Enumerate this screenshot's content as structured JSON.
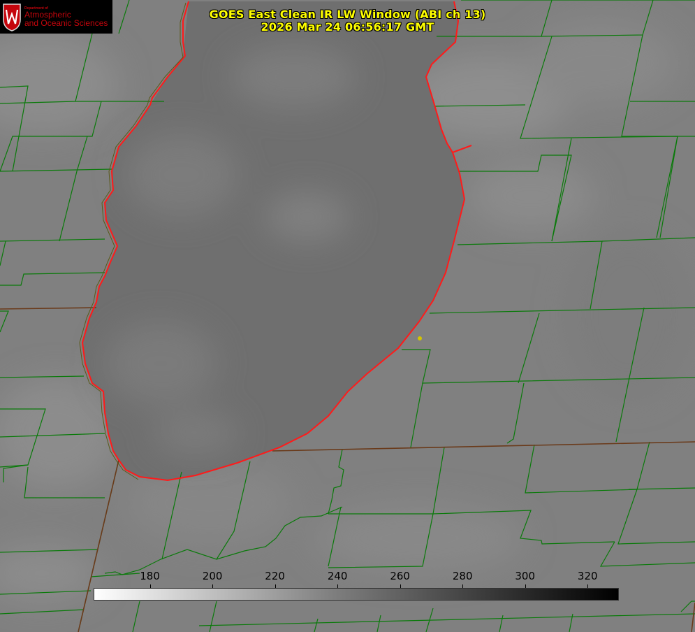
{
  "title": {
    "line1": "GOES East Clean IR LW Window (ABI ch 13)",
    "line2": "2026 Mar 24 06:56:17 GMT"
  },
  "logo": {
    "dept": "Department of",
    "line1": "Atmospheric",
    "line2": "and Oceanic Sciences",
    "color": "#c5050c"
  },
  "colors": {
    "title": "#ffff00",
    "county_lines": "#0a7a0a",
    "shoreline": "#ff1a1a",
    "marker": "#d4c400"
  },
  "colorbar": {
    "ticks": [
      180,
      200,
      220,
      240,
      260,
      280,
      300,
      320
    ],
    "range": [
      162,
      330
    ]
  }
}
